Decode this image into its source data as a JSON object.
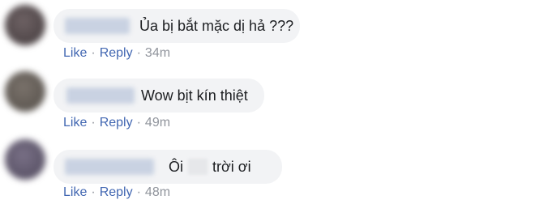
{
  "comments": [
    {
      "text": "Ủa bị bắt mặc dị hả ???",
      "like_label": "Like",
      "reply_label": "Reply",
      "separator": "·",
      "time": "34m",
      "avatar_color": "#5a5253"
    },
    {
      "text": "Wow bịt kín thiệt",
      "like_label": "Like",
      "reply_label": "Reply",
      "separator": "·",
      "time": "49m",
      "avatar_color": "#6c655e"
    },
    {
      "text_before": "Ôi",
      "text_after": "trời ơi",
      "like_label": "Like",
      "reply_label": "Reply",
      "separator": "·",
      "time": "48m",
      "avatar_color": "#6a6377"
    }
  ]
}
